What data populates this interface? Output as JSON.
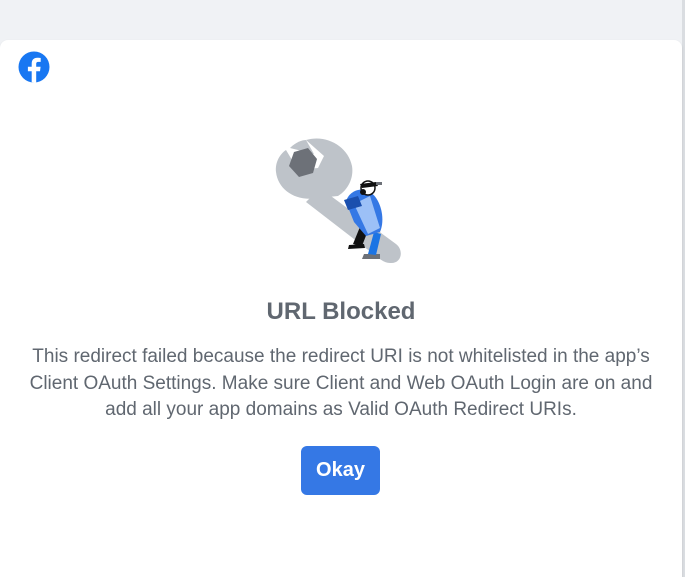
{
  "dialog": {
    "title": "URL Blocked",
    "message": "This redirect failed because the redirect URI is not whitelisted in the app’s Client OAuth Settings. Make sure Client and Web OAuth Login are on and add all your app domains as Valid OAuth Redirect URIs.",
    "okay_label": "Okay"
  },
  "icons": {
    "logo": "facebook-logo-icon",
    "illustration": "wrench-person-illustration"
  },
  "colors": {
    "background": "#f0f2f5",
    "card": "#ffffff",
    "text": "#606770",
    "button": "#3578e5",
    "facebook_blue": "#1877f2"
  }
}
